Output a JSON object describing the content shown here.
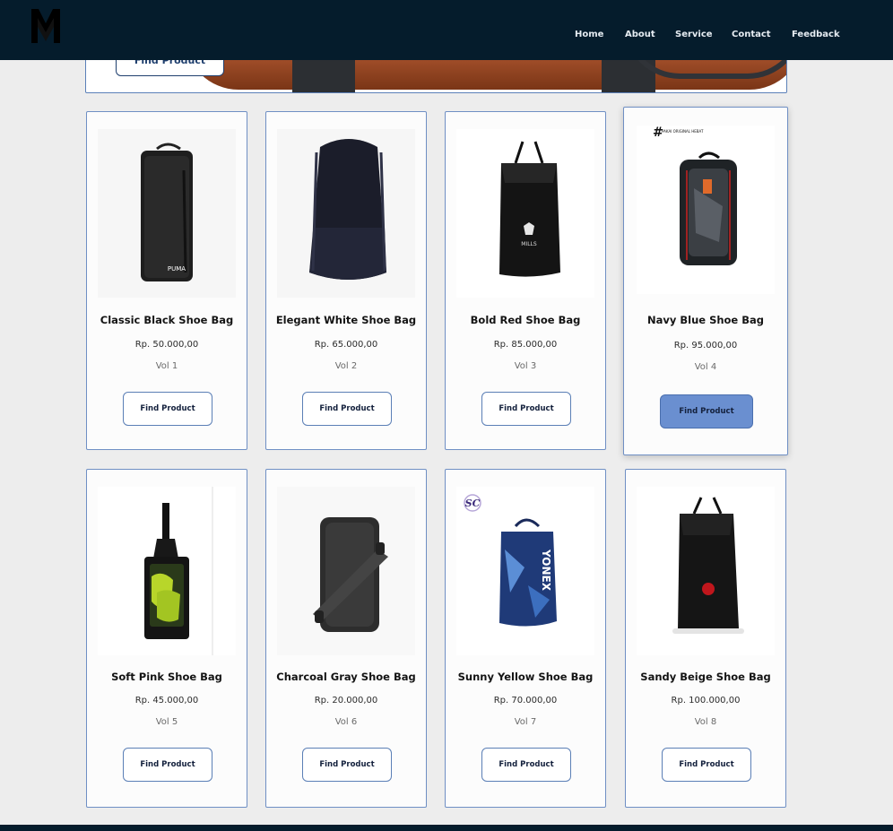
{
  "nav": {
    "links": [
      "Home",
      "About",
      "Service",
      "Contact",
      "Feedback"
    ]
  },
  "hero": {
    "button_label": "Find Product"
  },
  "products": [
    {
      "title": "Classic Black Shoe Bag",
      "price": "Rp. 50.000,00",
      "vol": "Vol 1",
      "button": "Find Product"
    },
    {
      "title": "Elegant White Shoe Bag",
      "price": "Rp. 65.000,00",
      "vol": "Vol 2",
      "button": "Find Product"
    },
    {
      "title": "Bold Red Shoe Bag",
      "price": "Rp. 85.000,00",
      "vol": "Vol 3",
      "button": "Find Product"
    },
    {
      "title": "Navy Blue Shoe Bag",
      "price": "Rp. 95.000,00",
      "vol": "Vol 4",
      "button": "Find Product"
    },
    {
      "title": "Soft Pink Shoe Bag",
      "price": "Rp. 45.000,00",
      "vol": "Vol 5",
      "button": "Find Product"
    },
    {
      "title": "Charcoal Gray Shoe Bag",
      "price": "Rp. 20.000,00",
      "vol": "Vol 6",
      "button": "Find Product"
    },
    {
      "title": "Sunny Yellow Shoe Bag",
      "price": "Rp. 70.000,00",
      "vol": "Vol 7",
      "button": "Find Product"
    },
    {
      "title": "Sandy Beige Shoe Bag",
      "price": "Rp. 100.000,00",
      "vol": "Vol 8",
      "button": "Find Product"
    }
  ],
  "product_images": {
    "image_1_text": "PUMA",
    "image_3_text": "MILLS",
    "image_4_text": "PAKAI ORIGINAL HEBAT",
    "image_7_text": "YONEX",
    "image_7_badge": "SC"
  },
  "colors": {
    "navbar": "#051c2c",
    "card_border": "#6f8fc4",
    "button_active": "#6a8fd0"
  }
}
